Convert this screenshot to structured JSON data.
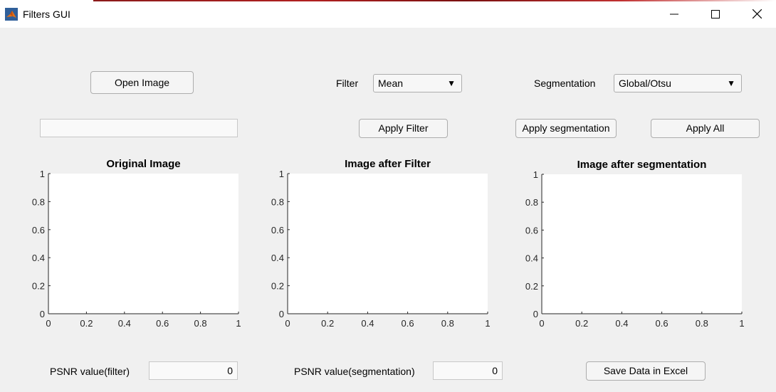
{
  "window": {
    "title": "Filters GUI",
    "icon": "matlab-icon",
    "minimize_icon": "minimize-icon",
    "maximize_icon": "maximize-icon",
    "close_icon": "close-icon"
  },
  "controls": {
    "open_image_label": "Open Image",
    "image_path_value": "",
    "filter_label": "Filter",
    "filter_selected": "Mean",
    "segmentation_label": "Segmentation",
    "segmentation_selected": "Global/Otsu",
    "apply_filter_label": "Apply Filter",
    "apply_segmentation_label": "Apply segmentation",
    "apply_all_label": "Apply All"
  },
  "axes": [
    {
      "title": "Original Image",
      "xticks": [
        "0",
        "0.2",
        "0.4",
        "0.6",
        "0.8",
        "1"
      ],
      "yticks": [
        "0",
        "0.2",
        "0.4",
        "0.6",
        "0.8",
        "1"
      ]
    },
    {
      "title": "Image after Filter",
      "xticks": [
        "0",
        "0.2",
        "0.4",
        "0.6",
        "0.8",
        "1"
      ],
      "yticks": [
        "0",
        "0.2",
        "0.4",
        "0.6",
        "0.8",
        "1"
      ]
    },
    {
      "title": "Image after segmentation",
      "xticks": [
        "0",
        "0.2",
        "0.4",
        "0.6",
        "0.8",
        "1"
      ],
      "yticks": [
        "0",
        "0.2",
        "0.4",
        "0.6",
        "0.8",
        "1"
      ]
    }
  ],
  "footer": {
    "psnr_filter_label": "PSNR value(filter)",
    "psnr_filter_value": "0",
    "psnr_segmentation_label": "PSNR value(segmentation)",
    "psnr_segmentation_value": "0",
    "save_label": "Save Data in Excel"
  }
}
